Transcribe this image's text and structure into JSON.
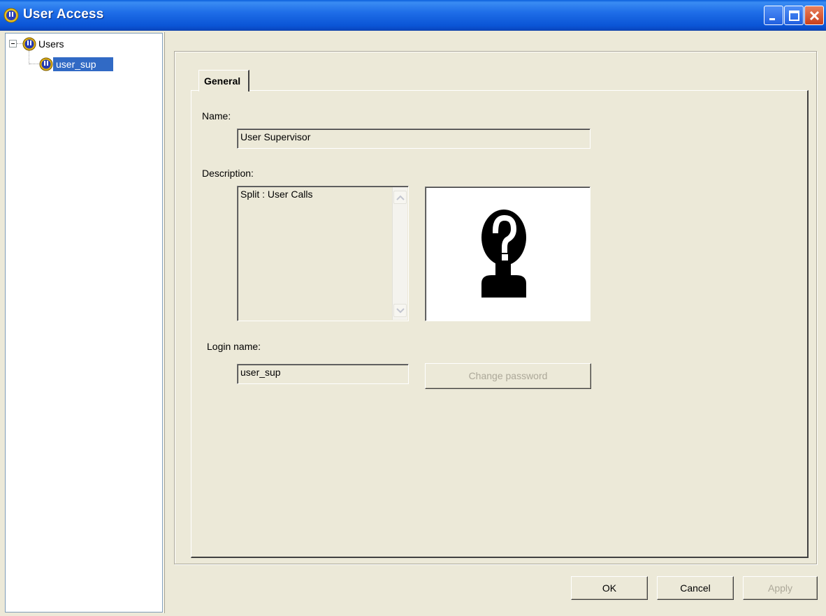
{
  "window": {
    "title": "User Access",
    "icon": "user-access-icon"
  },
  "tree": {
    "root_label": "Users",
    "child_label": "user_sup"
  },
  "tabs": [
    {
      "label": "General",
      "active": true
    }
  ],
  "form": {
    "name_label": "Name:",
    "name_value": "User Supervisor",
    "description_label": "Description:",
    "description_value": "Split : User Calls",
    "login_label": "Login name:",
    "login_value": "user_sup",
    "change_password_label": "Change password"
  },
  "buttons": {
    "ok": "OK",
    "cancel": "Cancel",
    "apply": "Apply"
  },
  "colors": {
    "titlebar": "#1f6ee8",
    "face": "#ece9d8",
    "selection": "#316ac5"
  }
}
